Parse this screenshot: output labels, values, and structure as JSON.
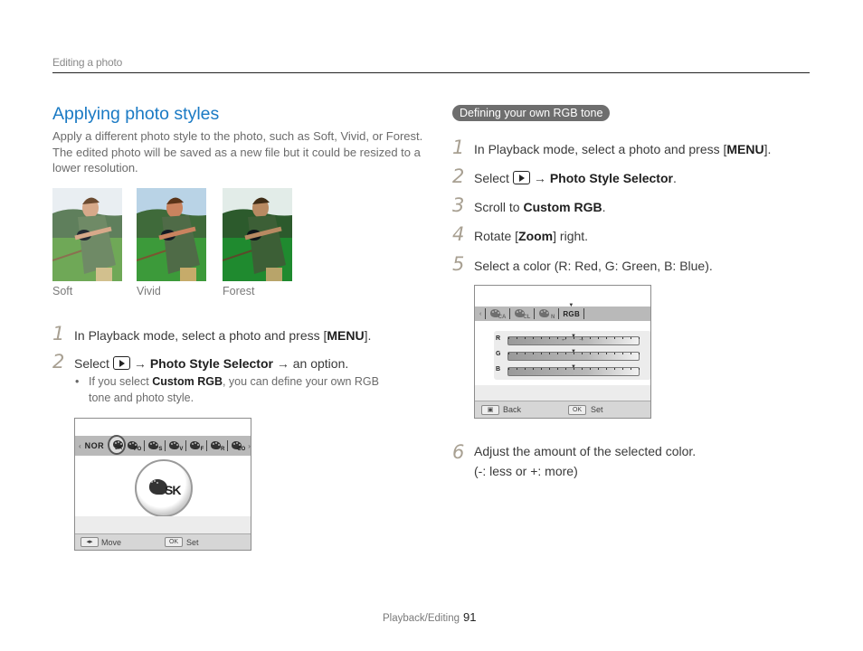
{
  "header": {
    "running_head": "Editing a photo"
  },
  "left": {
    "title": "Applying photo styles",
    "intro": "Apply a different photo style to the photo, such as Soft, Vivid, or Forest. The edited photo will be saved as a new file but it could be resized to a lower resolution.",
    "thumbnails": [
      {
        "caption": "Soft"
      },
      {
        "caption": "Vivid"
      },
      {
        "caption": "Forest"
      }
    ],
    "steps": [
      {
        "num": "1",
        "pre": "In Playback mode, select a photo and press [",
        "key": "MENU",
        "post": "]."
      },
      {
        "num": "2",
        "pre": "Select",
        "arrow1": "→",
        "bold": "Photo Style Selector",
        "arrow2": "→",
        "post": "an option."
      }
    ],
    "note": {
      "pre": "If you select ",
      "bold": "Custom RGB",
      "post": ", you can define your own RGB tone and photo style."
    },
    "screen": {
      "left_arrow": "‹",
      "right_arrow": "›",
      "first_item": "NOR",
      "items": [
        "SK",
        "FO",
        "S",
        "V",
        "F",
        "R",
        "CO"
      ],
      "preview_label": "SK",
      "foot_key1": "◂▸",
      "foot_label1": "Move",
      "foot_key2": "OK",
      "foot_label2": "Set"
    }
  },
  "right": {
    "pill": "Defining your own RGB tone",
    "steps": [
      {
        "num": "1",
        "pre": "In Playback mode, select a photo and press [",
        "key": "MENU",
        "post": "]."
      },
      {
        "num": "2",
        "pre": "Select",
        "arrow": "→",
        "bold": "Photo Style Selector",
        "post": "."
      },
      {
        "num": "3",
        "pre": "Scroll to ",
        "bold": "Custom RGB",
        "post": "."
      },
      {
        "num": "4",
        "pre": "Rotate [",
        "bold": "Zoom",
        "post": "] right."
      },
      {
        "num": "5",
        "pre": "Select a color (R: Red, G: Green, B: Blue)."
      },
      {
        "num": "6",
        "pre": "Adjust the amount of the selected color.",
        "line2": "(-: less or +: more)"
      }
    ],
    "screen": {
      "left_arrow": "‹",
      "items": [
        "CA",
        "CL",
        "N"
      ],
      "selected_item": "RGB",
      "sliders": [
        {
          "label": "R",
          "value": 0,
          "selected": true
        },
        {
          "label": "G",
          "value": 0,
          "selected": false
        },
        {
          "label": "B",
          "value": 0,
          "selected": false
        }
      ],
      "foot_key1": "▣",
      "foot_label1": "Back",
      "foot_key2": "OK",
      "foot_label2": "Set"
    }
  },
  "footer": {
    "section": "Playback/Editing",
    "page": "91"
  }
}
